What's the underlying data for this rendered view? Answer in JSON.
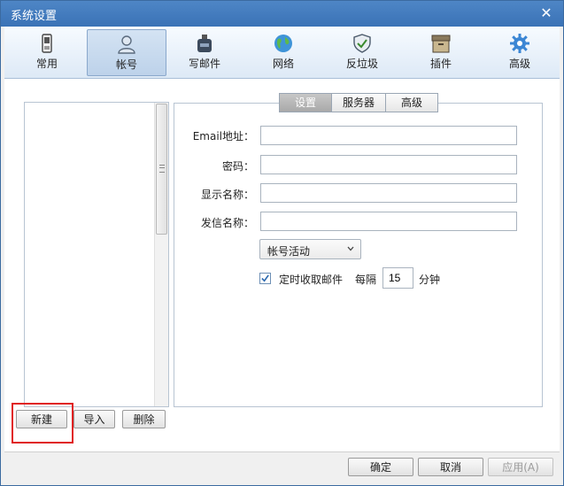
{
  "window": {
    "title": "系统设置"
  },
  "toolbar": {
    "items": [
      {
        "label": "常用",
        "icon": "phone-icon"
      },
      {
        "label": "帐号",
        "icon": "user-icon"
      },
      {
        "label": "写邮件",
        "icon": "ink-bottle-icon"
      },
      {
        "label": "网络",
        "icon": "globe-icon"
      },
      {
        "label": "反垃圾",
        "icon": "shield-icon"
      },
      {
        "label": "插件",
        "icon": "box-icon"
      },
      {
        "label": "高级",
        "icon": "gear-icon"
      }
    ],
    "active_index": 1
  },
  "account": {
    "buttons": {
      "new": "新建",
      "import": "导入",
      "delete": "删除"
    }
  },
  "tabs": {
    "items": [
      "设置",
      "服务器",
      "高级"
    ],
    "active_index": 0
  },
  "form": {
    "email_label": "Email地址：",
    "email_value": "",
    "password_label": "密码：",
    "password_value": "",
    "display_name_label": "显示名称：",
    "display_name_value": "",
    "sender_name_label": "发信名称：",
    "sender_name_value": "",
    "status_select": "帐号活动",
    "auto_check_label": "定时收取邮件",
    "auto_check_checked": true,
    "interval_prefix": "每隔",
    "interval_value": "15",
    "interval_unit": "分钟"
  },
  "footer": {
    "ok": "确定",
    "cancel": "取消",
    "apply": "应用(A)"
  },
  "colors": {
    "titlebar": "#3a72b6",
    "highlight_border": "#e02020",
    "accent": "#2e6bb0"
  }
}
